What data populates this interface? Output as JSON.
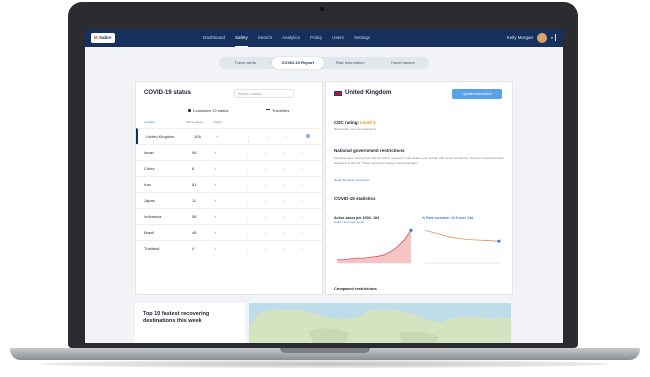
{
  "app": {
    "logo_mark": "M",
    "logo_text": "Sabre",
    "nav": [
      "Dashboard",
      "Safety",
      "Search",
      "Analytics",
      "Policy",
      "Users",
      "Settings"
    ],
    "nav_active": "Safety",
    "user_name": "Kelly Morgan"
  },
  "tabs": [
    "Travel alerts",
    "COVID-19 Report",
    "Risk information",
    "Travel tracker"
  ],
  "tabs_active": "COVID-19 Report",
  "left": {
    "title": "COVID-19 status",
    "search_placeholder": "Search location",
    "group_lockdown": "Lockdown 19 status",
    "group_travel": "Travellers",
    "columns": [
      "Location",
      "Active cases",
      "Trend"
    ],
    "rows": [
      {
        "name": "United Kingdom",
        "value": "108",
        "trend": "↑"
      },
      {
        "name": "Israel",
        "value": "98",
        "trend": "↑"
      },
      {
        "name": "China",
        "value": "8",
        "trend": "↓"
      },
      {
        "name": "Iran",
        "value": "81",
        "trend": "↑"
      },
      {
        "name": "Japan",
        "value": "11",
        "trend": "↑"
      },
      {
        "name": "Indonesia",
        "value": "58",
        "trend": "↑"
      },
      {
        "name": "Brazil",
        "value": "48",
        "trend": "↑"
      },
      {
        "name": "Thailand",
        "value": "4",
        "trend": "↓"
      }
    ]
  },
  "right": {
    "country": "United Kingdom",
    "button": "Update information",
    "cdc_label": "CDC rating:",
    "cdc_level": "Level 3",
    "cdc_sub": "Reconsider non-essential travel",
    "gov_title": "National government restrictions",
    "gov_body": "All passengers arriving from the UK will be required to self-isolate upon arrival, with some exemptions. Testing is required before departure to the UK. These restrictions apply to all passengers.",
    "gov_link": "Read the latest restrictions",
    "stats_title": "COVID-19 statistics",
    "stat1_label": "Active cases per 100K: 184",
    "stat1_sub": "Higher than last month",
    "stat2_label": "% Rate increase: 13.6 over 14d",
    "comparison": "Compared restrictions"
  },
  "bottom": {
    "title": "Top 10 fastest recovering destinations this week"
  },
  "chart_data": [
    {
      "type": "area",
      "series": [
        {
          "values": [
            2,
            2,
            2.5,
            3,
            3,
            3.5,
            4,
            5,
            7,
            10,
            14,
            20
          ]
        }
      ]
    },
    {
      "type": "line",
      "series": [
        {
          "values": [
            9,
            8.5,
            8,
            7.5,
            7,
            6.8,
            6.5,
            6.4,
            6.3,
            6.2,
            6.1,
            6
          ]
        }
      ]
    }
  ]
}
